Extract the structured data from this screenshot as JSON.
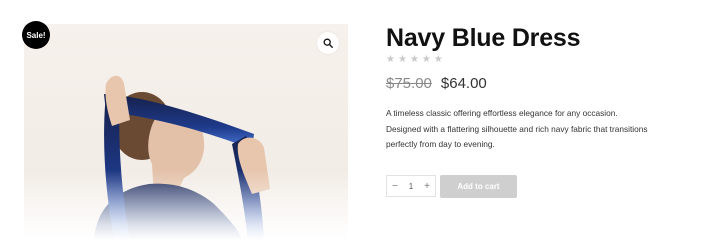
{
  "product": {
    "badge": "Sale!",
    "title": "Navy Blue Dress",
    "rating": {
      "stars": 5,
      "filled": 0,
      "star_color": "#c9c9c9",
      "star_glyph": "★"
    },
    "old_price": "$75.00",
    "new_price": "$64.00",
    "description_lines": [
      "A timeless classic offering effortless elegance for any occasion.",
      "Designed with a flattering silhouette and rich navy fabric that transitions",
      "perfectly from day to evening."
    ]
  },
  "gallery": {
    "zoom_icon": "magnifier-icon",
    "image": "model-with-navy-fabric"
  },
  "cart": {
    "quantity": "1",
    "minus": "−",
    "plus": "+",
    "add_label": "Add to cart"
  },
  "colors": {
    "badge_bg": "#000000",
    "navy": "#1b2a55",
    "button_bg": "#cfcfcf"
  }
}
